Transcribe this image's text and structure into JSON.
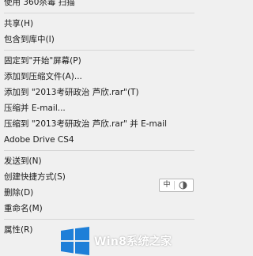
{
  "context_menu": {
    "items": [
      {
        "label": "使用 360杀毒 扫描"
      },
      {
        "label": "共享(H)"
      },
      {
        "label": "包含到库中(I)"
      },
      {
        "label": "固定到\"开始\"屏幕(P)"
      },
      {
        "label": "添加到压缩文件(A)..."
      },
      {
        "label": "添加到 \"2013考研政治 芦欣.rar\"(T)"
      },
      {
        "label": "压缩并 E-mail..."
      },
      {
        "label": "压缩到 \"2013考研政治 芦欣.rar\" 并 E-mail"
      },
      {
        "label": "Adobe Drive CS4"
      },
      {
        "label": "发送到(N)"
      },
      {
        "label": "创建快捷方式(S)"
      },
      {
        "label": "删除(D)"
      },
      {
        "label": "重命名(M)"
      },
      {
        "label": "属性(R)"
      }
    ]
  },
  "ime_toolbar": {
    "mode_label": "中",
    "moon_icon": "half-moon-icon"
  },
  "watermark": {
    "text": "Win8系统之家",
    "logo_icon": "windows-logo-icon",
    "logo_color": "#1e7fd8"
  }
}
